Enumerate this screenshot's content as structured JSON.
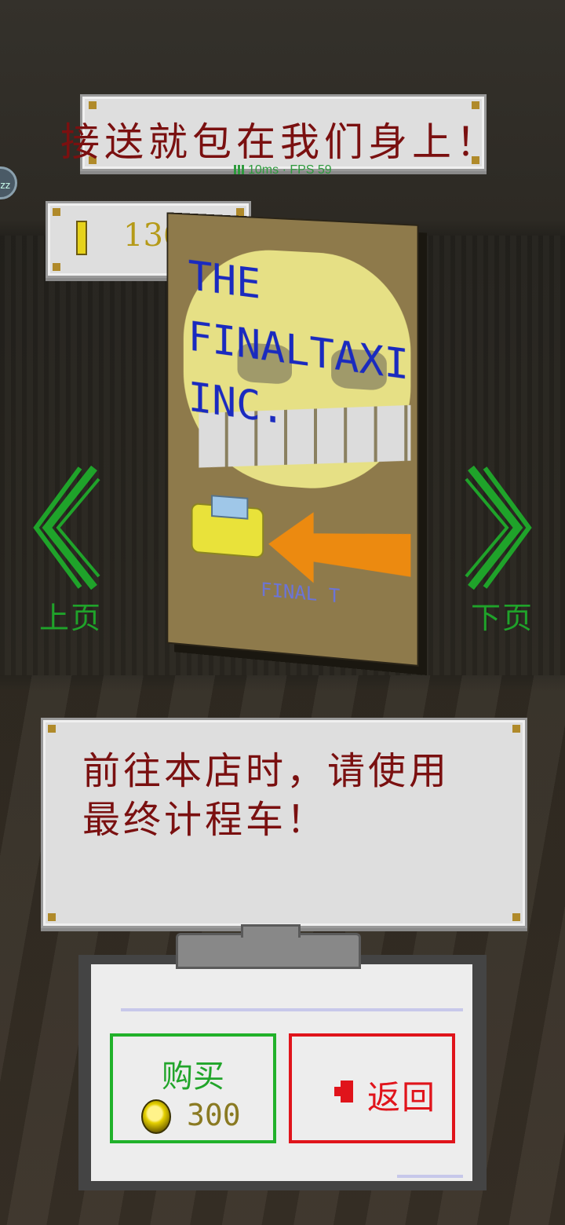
{
  "hud": {
    "title": "接送就包在我们身上！",
    "network": "10ms · FPS 59",
    "badge": "zz",
    "coins": "136"
  },
  "poster": {
    "title_lines": [
      "THE",
      "FINALTAXI",
      "INC."
    ],
    "footer": "FINAL T"
  },
  "nav": {
    "prev_label": "上页",
    "next_label": "下页"
  },
  "description": {
    "line1": "前往本店时，请使用",
    "line2": "最终计程车！"
  },
  "actions": {
    "buy_label": "购买",
    "price": "300",
    "back_label": "返回"
  },
  "colors": {
    "text_red": "#7a1010",
    "accent_green": "#21b12a",
    "accent_red": "#e0141b",
    "poster_blue": "#1a2abf"
  },
  "icons": [
    "coin-icon",
    "chevron-left-icon",
    "chevron-right-icon",
    "back-arrow-icon",
    "signal-icon"
  ]
}
